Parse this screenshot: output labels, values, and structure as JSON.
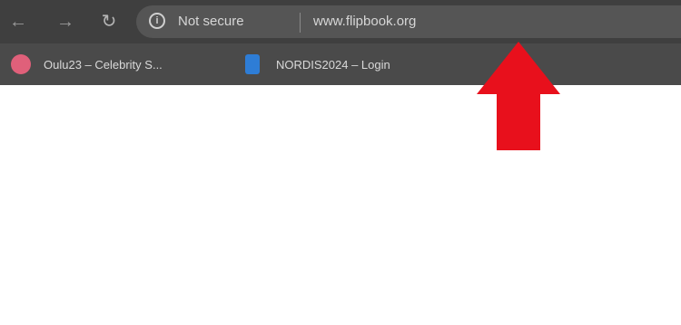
{
  "toolbar": {
    "back_icon": "←",
    "forward_icon": "→",
    "reload_icon": "↻",
    "address": {
      "info_icon": "i",
      "security_label": "Not secure",
      "url": "www.flipbook.org"
    }
  },
  "bookmarks": [
    {
      "icon": "pink-circle-favicon",
      "label": "Oulu23 – Celebrity S..."
    },
    {
      "icon": "blue-favicon",
      "label": "NORDIS2024 – Login"
    }
  ],
  "colors": {
    "chrome_bg": "#4a4a4a",
    "toolbar_bg": "#3f3f3f",
    "arrow": "#e8101c"
  },
  "annotation": {
    "arrow_icon": "red-up-arrow-icon"
  }
}
